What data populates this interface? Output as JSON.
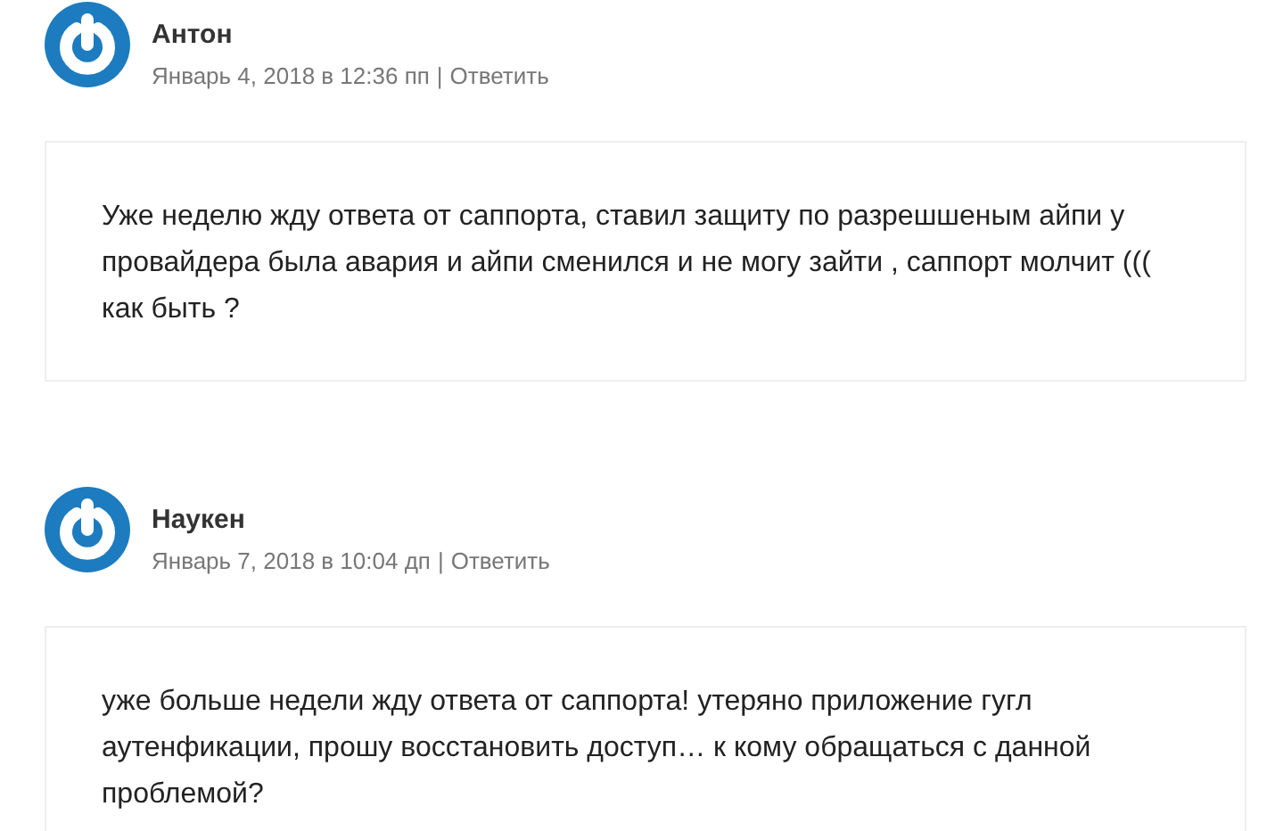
{
  "comments": [
    {
      "author": "Антон",
      "date": "Январь 4, 2018 в 12:36 пп",
      "separator": "|",
      "reply": "Ответить",
      "text": "Уже неделю жду ответа от саппорта, ставил защиту по разрешшеным айпи у провайдера была авария и айпи сменился и не могу зайти , саппорт молчит ((( как быть ?"
    },
    {
      "author": "Наукен",
      "date": "Январь 7, 2018 в 10:04 дп",
      "separator": "|",
      "reply": "Ответить",
      "text": "уже больше недели жду ответа от саппорта! утеряно приложение гугл аутенфикации, прошу восстановить доступ… к кому обращаться с данной проблемой?"
    }
  ]
}
